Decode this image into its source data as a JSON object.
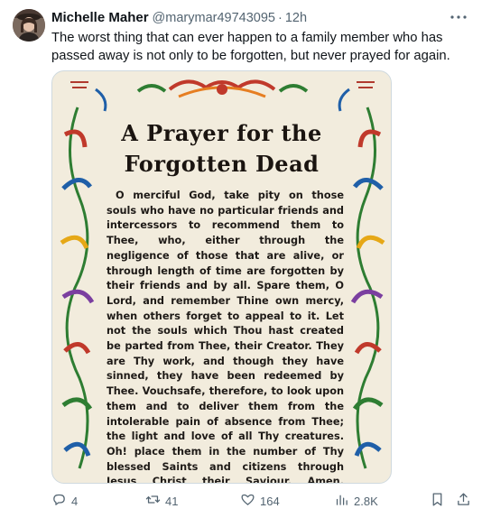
{
  "tweet": {
    "author_name": "Michelle Maher",
    "handle": "@marymar49743095",
    "separator": "·",
    "time": "12h",
    "text": "The worst thing that can ever happen to a family member who has passed away is not only to be forgotten, but never prayed for again."
  },
  "image": {
    "title_line1": "A Prayer for the",
    "title_line2": "Forgotten Dead",
    "body": "O merciful God, take pity on those souls who have no particular friends and intercessors to recommend them to Thee, who, either through the negligence of those that are alive, or through length of time are forgotten by their friends and by all. Spare them, O Lord, and remember Thine own mercy, when others forget to appeal to it. Let not the souls which Thou hast created be parted from Thee, their Creator. They are Thy work, and though they have sinned, they have been redeemed by Thee. Vouchsafe, therefore, to look upon them and to deliver them from the intolerable pain of absence from Thee; the light and love of all Thy creatures. Oh! place them in the number of Thy blessed Saints and citizens through Jesus Christ their Saviour. Amen."
  },
  "actions": {
    "replies": "4",
    "reposts": "41",
    "likes": "164",
    "views": "2.8K"
  },
  "icons": {
    "more": "more-dots-icon",
    "reply": "reply-icon",
    "repost": "repost-icon",
    "like": "heart-icon",
    "views": "views-icon",
    "bookmark": "bookmark-icon",
    "share": "share-icon"
  },
  "colors": {
    "text_primary": "#0f1419",
    "text_secondary": "#536471",
    "card_background": "#f2ecdd"
  }
}
